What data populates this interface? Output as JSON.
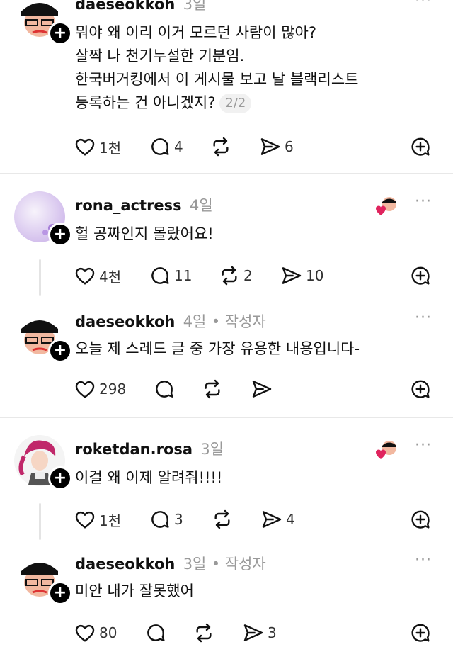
{
  "posts": [
    {
      "username": "daeseokkoh",
      "time": "3일",
      "author_tag": "",
      "text": "뭐야 왜 이리 이거 모르던 사람이 많아?\n살짝 나 천기누설한 기분임.\n한국버거킹에서 이 게시물 보고 날 블랙리스트\n등록하는 건 아니겠지?",
      "page_indicator": "2/2",
      "likes": "1천",
      "comments": "4",
      "reposts": "",
      "shares": "6"
    },
    {
      "username": "rona_actress",
      "time": "4일",
      "author_tag": "",
      "text": "헐 공짜인지 몰랐어요!",
      "likes": "4천",
      "comments": "11",
      "reposts": "2",
      "shares": "10"
    },
    {
      "username": "daeseokkoh",
      "time": "4일",
      "author_tag": "• 작성자",
      "text": "오늘 제 스레드 글 중 가장 유용한 내용입니다-",
      "likes": "298",
      "comments": "",
      "reposts": "",
      "shares": ""
    },
    {
      "username": "roketdan.rosa",
      "time": "3일",
      "author_tag": "",
      "text": "이걸 왜 이제 알려줘!!!!",
      "likes": "1천",
      "comments": "3",
      "reposts": "",
      "shares": "4"
    },
    {
      "username": "daeseokkoh",
      "time": "3일",
      "author_tag": "• 작성자",
      "text": "미안 내가 잘못했어",
      "likes": "80",
      "comments": "",
      "reposts": "",
      "shares": "3"
    }
  ],
  "more_label": "···",
  "follow_label": "+",
  "icons": {
    "like": "heart-icon",
    "comment": "comment-icon",
    "repost": "repost-icon",
    "share": "send-icon",
    "save": "add-circle-icon"
  },
  "colors": {
    "text": "#111111",
    "meta": "#999999",
    "liked": "#e0245e"
  }
}
